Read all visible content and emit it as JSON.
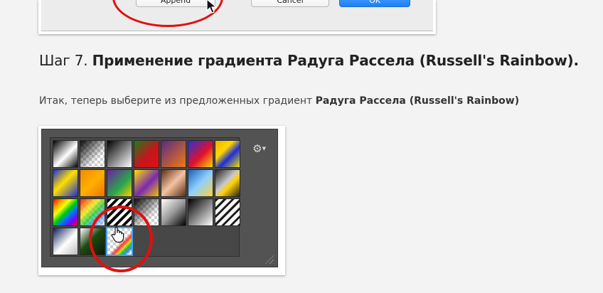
{
  "dialog": {
    "apply_label": "Append",
    "cancel_label": "Cancel",
    "ok_label": "OK"
  },
  "heading": {
    "prefix": "Шаг 7. ",
    "bold": "Применение градиента Радуга Рассела (Russell's Rainbow)."
  },
  "paragraph": {
    "text": "Итак, теперь выберите из предложенных градиент ",
    "bold": "Радуга Рассела (Russell's Rainbow)"
  },
  "panel": {
    "gear_icon": "gear-icon",
    "selected_swatch_index": 23,
    "swatches": [
      "linear-gradient(135deg,#000 0%,#fff 55%,#000 100%)",
      "checker-fade",
      "linear-gradient(135deg,#000 0%,#fff 100%)",
      "linear-gradient(135deg,#1b7d1b 0%,#c4161c 55%,#e01010 100%)",
      "linear-gradient(135deg,#5a2a86 0%,#f07a10 100%)",
      "linear-gradient(135deg,#2434d6 0%,#e0102c 55%,#ffd800 100%)",
      "linear-gradient(135deg,#f0b000 0%,#ffd800 35%,#1d2fd6 60%,#f0e000 100%)",
      "linear-gradient(135deg,#1d2fd6 0%,#ffe000 45%,#1d2fd6 100%)",
      "linear-gradient(135deg,#f08a00 0%,#ffb000 50%,#f07000 100%)",
      "linear-gradient(135deg,#6c1fa0 0%,#2aa84a 60%,#ffd000 100%)",
      "linear-gradient(135deg,#ffe000 0%,#7a2ab0 55%,#f0c000 100%)",
      "linear-gradient(135deg,#5a2d18 0%,#f4c3a0 50%,#5a2d18 100%)",
      "linear-gradient(135deg,#1c5fb8 0%,#8fd0ff 50%,#ffd23a 100%)",
      "linear-gradient(135deg,#222 0%,#c9c9c9 45%,#ffd200 60%,#222 100%)",
      "linear-gradient(135deg,#ff0000 0%,#ff9a00 18%,#ffff00 34%,#00d000 50%,#0070ff 66%,#7a00ff 82%,#ff0000 100%)",
      "rainbow-checker",
      "stripes-dark",
      "checker-fade",
      "linear-gradient(135deg,#fff 0%,#999 50%,#000 100%)",
      "linear-gradient(135deg,#000 0%,#fff 100%)",
      "stripes-light",
      "linear-gradient(135deg,#10205a 0%,#fff 55%,#bcbcbc 100%)",
      "linear-gradient(135deg,#fff 0%,#1e4a12 45%,#0a1a06 100%)",
      "russell-rainbow"
    ]
  }
}
